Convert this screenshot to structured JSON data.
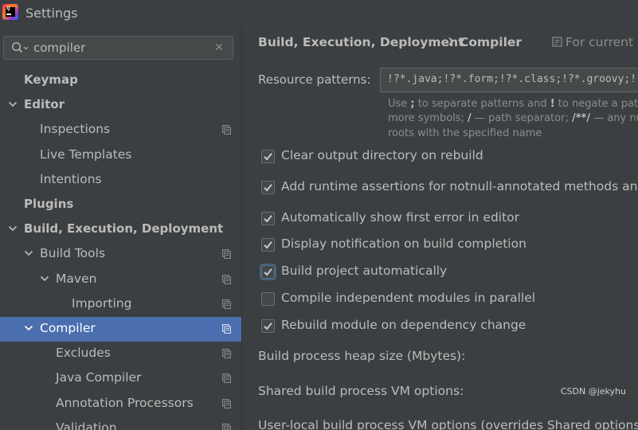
{
  "window": {
    "title": "Settings",
    "logo_text": "IJ"
  },
  "search": {
    "value": "compiler",
    "placeholder": ""
  },
  "tree": [
    {
      "label": "Keymap",
      "bold": true,
      "indent": 0,
      "chevron": "none",
      "copy": false,
      "selected": false
    },
    {
      "label": "Editor",
      "bold": true,
      "indent": 0,
      "chevron": "down",
      "copy": false,
      "selected": false
    },
    {
      "label": "Inspections",
      "bold": false,
      "indent": 1,
      "chevron": "none",
      "copy": true,
      "selected": false
    },
    {
      "label": "Live Templates",
      "bold": false,
      "indent": 1,
      "chevron": "none",
      "copy": false,
      "selected": false
    },
    {
      "label": "Intentions",
      "bold": false,
      "indent": 1,
      "chevron": "none",
      "copy": false,
      "selected": false
    },
    {
      "label": "Plugins",
      "bold": true,
      "indent": 0,
      "chevron": "none",
      "copy": false,
      "selected": false
    },
    {
      "label": "Build, Execution, Deployment",
      "bold": true,
      "indent": 0,
      "chevron": "down",
      "copy": false,
      "selected": false
    },
    {
      "label": "Build Tools",
      "bold": false,
      "indent": 1,
      "chevron": "down",
      "copy": true,
      "selected": false
    },
    {
      "label": "Maven",
      "bold": false,
      "indent": 2,
      "chevron": "down",
      "copy": true,
      "selected": false
    },
    {
      "label": "Importing",
      "bold": false,
      "indent": 3,
      "chevron": "none",
      "copy": true,
      "selected": false
    },
    {
      "label": "Compiler",
      "bold": false,
      "indent": 1,
      "chevron": "down",
      "copy": true,
      "selected": true
    },
    {
      "label": "Excludes",
      "bold": false,
      "indent": 2,
      "chevron": "none",
      "copy": true,
      "selected": false
    },
    {
      "label": "Java Compiler",
      "bold": false,
      "indent": 2,
      "chevron": "none",
      "copy": true,
      "selected": false
    },
    {
      "label": "Annotation Processors",
      "bold": false,
      "indent": 2,
      "chevron": "none",
      "copy": true,
      "selected": false
    },
    {
      "label": "Validation",
      "bold": false,
      "indent": 2,
      "chevron": "none",
      "copy": true,
      "selected": false
    }
  ],
  "breadcrumb": {
    "parent": "Build, Execution, Deployment",
    "current": "Compiler",
    "scope": "For current p"
  },
  "resource": {
    "label": "Resource patterns:",
    "value": "!?*.java;!?*.form;!?*.class;!?*.groovy;!",
    "hint": [
      [
        "Use ",
        ";",
        " to separate patterns and ",
        "!",
        " to negate a pattern"
      ],
      [
        "more symbols; ",
        "/",
        " — path separator; ",
        "/**/",
        " — any num"
      ],
      [
        "roots with the specified name"
      ]
    ]
  },
  "options": [
    {
      "label": "Clear output directory on rebuild",
      "checked": true,
      "focused": false
    },
    {
      "label": "Add runtime assertions for notnull-annotated methods and pa",
      "checked": true,
      "focused": false
    },
    {
      "label": "Automatically show first error in editor",
      "checked": true,
      "focused": false
    },
    {
      "label": "Display notification on build completion",
      "checked": true,
      "focused": false
    },
    {
      "label": "Build project automatically",
      "checked": true,
      "focused": true
    },
    {
      "label": "Compile independent modules in parallel",
      "checked": false,
      "focused": false
    },
    {
      "label": "Rebuild module on dependency change",
      "checked": true,
      "focused": false
    }
  ],
  "fields": {
    "heap": "Build process heap size (Mbytes):",
    "shared_vm": "Shared build process VM options:",
    "user_vm": "User-local build process VM options (overrides Shared options):"
  },
  "watermark": "CSDN @jekyhu",
  "colors": {
    "background": "#3c3f41",
    "selection": "#4b6eaf",
    "text": "#bbbbbb",
    "field": "#45494a"
  },
  "icons": {
    "search": "search-icon",
    "clear": "close-icon",
    "chevron": "chevron-down-icon",
    "copy": "project-scope-icon",
    "check": "check-icon",
    "gear": "gear-icon"
  }
}
